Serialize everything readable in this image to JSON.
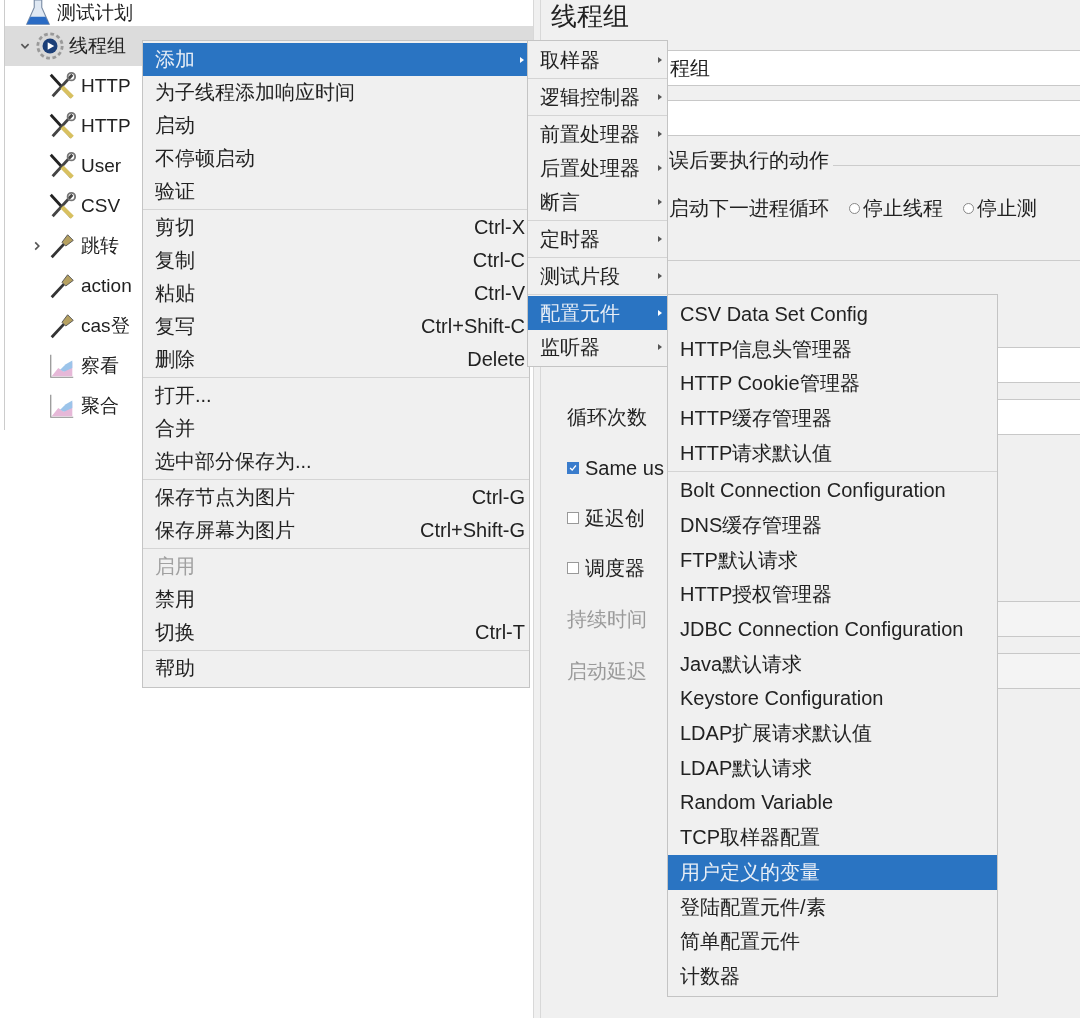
{
  "tree": [
    {
      "label": "测试计划",
      "kind": "plan",
      "selected": false,
      "children": [
        {
          "label": "线程组",
          "kind": "thread-group",
          "selected": true,
          "expanded": true,
          "children": [
            {
              "label": "HTTP",
              "kind": "config",
              "selected": false
            },
            {
              "label": "HTTP",
              "kind": "config",
              "selected": false
            },
            {
              "label": "User",
              "kind": "config",
              "selected": false
            },
            {
              "label": "CSV",
              "kind": "config",
              "selected": false
            },
            {
              "label": "跳转",
              "kind": "sampler",
              "selected": false,
              "expanded": false
            },
            {
              "label": "action",
              "kind": "sampler",
              "selected": false
            },
            {
              "label": "cas登",
              "kind": "sampler",
              "selected": false
            },
            {
              "label": "察看",
              "kind": "listener",
              "selected": false
            },
            {
              "label": "聚合",
              "kind": "listener",
              "selected": false
            }
          ]
        }
      ]
    }
  ],
  "panel": {
    "title": "线程组",
    "name_field": {
      "value": "程组"
    },
    "error_action": {
      "legend": "误后要执行的动作",
      "options": [
        {
          "label": "启动下一进程循环"
        },
        {
          "label": "停止线程",
          "selected": false
        },
        {
          "label": "停止测",
          "selected": false
        }
      ]
    },
    "properties": [
      {
        "kind": "field"
      },
      {
        "kind": "field",
        "label": "循环次数",
        "disabled": false
      },
      {
        "kind": "checkbox",
        "label": "Same us",
        "checked": true
      },
      {
        "kind": "checkbox",
        "label": "延迟创",
        "checked": false
      },
      {
        "kind": "checkbox",
        "label": "调度器",
        "checked": false
      },
      {
        "kind": "field",
        "label": "持续时间",
        "disabled": true
      },
      {
        "kind": "field",
        "label": "启动延迟",
        "disabled": true
      }
    ]
  },
  "menus": [
    {
      "entries": [
        {
          "kind": "item",
          "label": "添加",
          "submenu": true,
          "selected": true,
          "disabled": false
        },
        {
          "kind": "item",
          "label": "为子线程添加响应时间",
          "selected": false,
          "disabled": false
        },
        {
          "kind": "item",
          "label": "启动",
          "selected": false,
          "disabled": false
        },
        {
          "kind": "item",
          "label": "不停顿启动",
          "selected": false,
          "disabled": false
        },
        {
          "kind": "item",
          "label": "验证",
          "selected": false,
          "disabled": false
        },
        {
          "kind": "separator"
        },
        {
          "kind": "item",
          "label": "剪切",
          "shortcut": "Ctrl-X",
          "selected": false,
          "disabled": false
        },
        {
          "kind": "item",
          "label": "复制",
          "shortcut": "Ctrl-C",
          "selected": false,
          "disabled": false
        },
        {
          "kind": "item",
          "label": "粘贴",
          "shortcut": "Ctrl-V",
          "selected": false,
          "disabled": false
        },
        {
          "kind": "item",
          "label": "复写",
          "shortcut": "Ctrl+Shift-C",
          "selected": false,
          "disabled": false
        },
        {
          "kind": "item",
          "label": "删除",
          "shortcut": "Delete",
          "selected": false,
          "disabled": false
        },
        {
          "kind": "separator"
        },
        {
          "kind": "item",
          "label": "打开...",
          "selected": false,
          "disabled": false
        },
        {
          "kind": "item",
          "label": "合并",
          "selected": false,
          "disabled": false
        },
        {
          "kind": "item",
          "label": "选中部分保存为...",
          "selected": false,
          "disabled": false
        },
        {
          "kind": "separator"
        },
        {
          "kind": "item",
          "label": "保存节点为图片",
          "shortcut": "Ctrl-G",
          "selected": false,
          "disabled": false
        },
        {
          "kind": "item",
          "label": "保存屏幕为图片",
          "shortcut": "Ctrl+Shift-G",
          "selected": false,
          "disabled": false
        },
        {
          "kind": "separator"
        },
        {
          "kind": "item",
          "label": "启用",
          "selected": false,
          "disabled": true
        },
        {
          "kind": "item",
          "label": "禁用",
          "selected": false,
          "disabled": false
        },
        {
          "kind": "item",
          "label": "切换",
          "shortcut": "Ctrl-T",
          "selected": false,
          "disabled": false
        },
        {
          "kind": "separator"
        },
        {
          "kind": "item",
          "label": "帮助",
          "selected": false,
          "disabled": false
        }
      ]
    },
    {
      "entries": [
        {
          "kind": "item",
          "label": "取样器",
          "submenu": true,
          "selected": false
        },
        {
          "kind": "separator"
        },
        {
          "kind": "item",
          "label": "逻辑控制器",
          "submenu": true,
          "selected": false
        },
        {
          "kind": "separator"
        },
        {
          "kind": "item",
          "label": "前置处理器",
          "submenu": true,
          "selected": false
        },
        {
          "kind": "item",
          "label": "后置处理器",
          "submenu": true,
          "selected": false
        },
        {
          "kind": "item",
          "label": "断言",
          "submenu": true,
          "selected": false
        },
        {
          "kind": "separator"
        },
        {
          "kind": "item",
          "label": "定时器",
          "submenu": true,
          "selected": false
        },
        {
          "kind": "separator"
        },
        {
          "kind": "item",
          "label": "测试片段",
          "submenu": true,
          "selected": false
        },
        {
          "kind": "separator"
        },
        {
          "kind": "item",
          "label": "配置元件",
          "submenu": true,
          "selected": true
        },
        {
          "kind": "item",
          "label": "监听器",
          "submenu": true,
          "selected": false
        }
      ]
    },
    {
      "entries": [
        {
          "kind": "item",
          "label": "CSV Data Set Config",
          "selected": false
        },
        {
          "kind": "item",
          "label": "HTTP信息头管理器",
          "selected": false
        },
        {
          "kind": "item",
          "label": "HTTP Cookie管理器",
          "selected": false
        },
        {
          "kind": "item",
          "label": "HTTP缓存管理器",
          "selected": false
        },
        {
          "kind": "item",
          "label": "HTTP请求默认值",
          "selected": false
        },
        {
          "kind": "separator"
        },
        {
          "kind": "item",
          "label": "Bolt Connection Configuration",
          "selected": false
        },
        {
          "kind": "item",
          "label": "DNS缓存管理器",
          "selected": false
        },
        {
          "kind": "item",
          "label": "FTP默认请求",
          "selected": false
        },
        {
          "kind": "item",
          "label": "HTTP授权管理器",
          "selected": false
        },
        {
          "kind": "item",
          "label": "JDBC Connection Configuration",
          "selected": false
        },
        {
          "kind": "item",
          "label": "Java默认请求",
          "selected": false
        },
        {
          "kind": "item",
          "label": "Keystore Configuration",
          "selected": false
        },
        {
          "kind": "item",
          "label": "LDAP扩展请求默认值",
          "selected": false
        },
        {
          "kind": "item",
          "label": "LDAP默认请求",
          "selected": false
        },
        {
          "kind": "item",
          "label": "Random Variable",
          "selected": false
        },
        {
          "kind": "item",
          "label": "TCP取样器配置",
          "selected": false
        },
        {
          "kind": "item",
          "label": "用户定义的变量",
          "selected": true
        },
        {
          "kind": "item",
          "label": "登陆配置元件/素",
          "selected": false
        },
        {
          "kind": "item",
          "label": "简单配置元件",
          "selected": false
        },
        {
          "kind": "item",
          "label": "计数器",
          "selected": false
        }
      ]
    }
  ]
}
